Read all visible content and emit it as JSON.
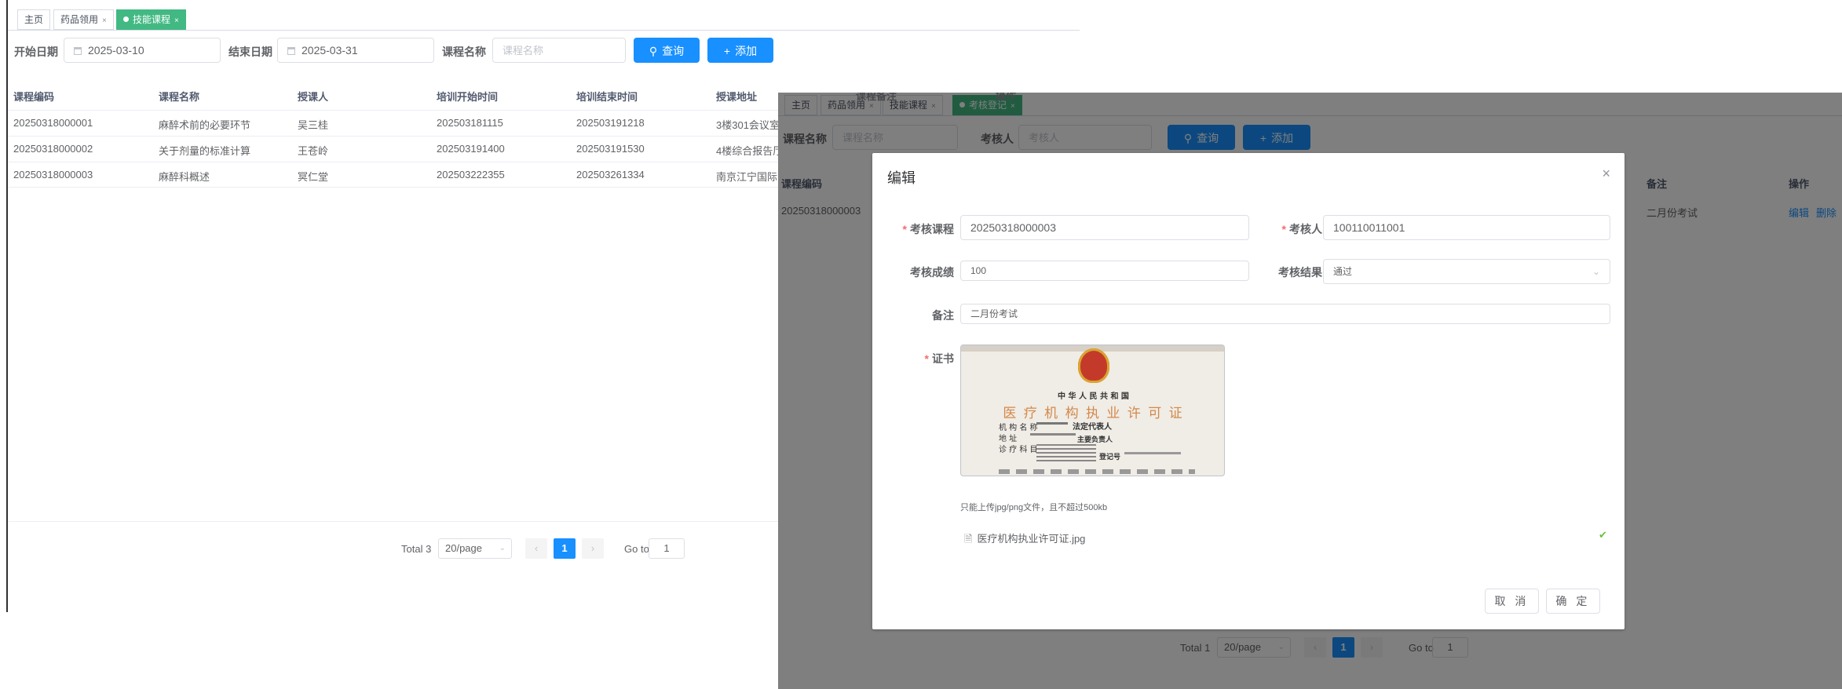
{
  "left_window": {
    "tabs": [
      {
        "label": "主页",
        "closable": false,
        "active": false
      },
      {
        "label": "药品领用",
        "closable": true,
        "active": false
      },
      {
        "label": "技能课程",
        "closable": true,
        "active": true
      }
    ],
    "filters": {
      "start_label": "开始日期",
      "start_value": "2025-03-10",
      "end_label": "结束日期",
      "end_value": "2025-03-31",
      "name_label": "课程名称",
      "name_placeholder": "课程名称",
      "search_label": "查询",
      "add_label": "添加"
    },
    "table": {
      "columns": [
        "课程编码",
        "课程名称",
        "授课人",
        "培训开始时间",
        "培训结束时间",
        "授课地址"
      ],
      "rows": [
        [
          "20250318000001",
          "麻醉术前的必要环节",
          "吴三桂",
          "202503181115",
          "202503191218",
          "3楼301会议室"
        ],
        [
          "20250318000002",
          "关于剂量的标准计算",
          "王苍岭",
          "202503191400",
          "202503191530",
          "4楼综合报告厅"
        ],
        [
          "20250318000003",
          "麻醉科概述",
          "冥仁堂",
          "202503222355",
          "202503261334",
          "南京江宁国际"
        ]
      ]
    },
    "pager": {
      "total": "Total 3",
      "size": "20/page",
      "page": "1",
      "goto_label": "Go to",
      "goto_value": "1"
    }
  },
  "right_window": {
    "tabs": [
      {
        "label": "主页",
        "closable": false,
        "active": false
      },
      {
        "label": "药品领用",
        "closable": true,
        "active": false
      },
      {
        "label": "技能课程",
        "closable": true,
        "active": false
      },
      {
        "label": "考核登记",
        "closable": true,
        "active": true
      }
    ],
    "hidden_headers": [
      "课程备注",
      "操作"
    ],
    "filters": {
      "name_label": "课程名称",
      "name_placeholder": "课程名称",
      "person_label": "考核人",
      "person_placeholder": "考核人",
      "search_label": "查询",
      "add_label": "添加"
    },
    "table": {
      "columns": [
        "课程编码",
        "备注",
        "操作"
      ],
      "row": {
        "code": "20250318000003",
        "remark": "二月份考试",
        "edit": "编辑",
        "delete": "删除"
      }
    },
    "pager": {
      "total": "Total 1",
      "size": "20/page",
      "page": "1",
      "goto_label": "Go to",
      "goto_value": "1"
    },
    "dialog": {
      "title": "编辑",
      "course_label": "考核课程",
      "course_value": "20250318000003",
      "person_label": "考核人",
      "person_value": "100110011001",
      "score_label": "考核成绩",
      "score_value": "100",
      "result_label": "考核结果",
      "result_value": "通过",
      "remark_label": "备注",
      "remark_value": "二月份考试",
      "cert_label": "证书",
      "cert": {
        "line1": "中 华 人 民 共 和 国",
        "line2": "医 疗 机 构 执 业 许 可 证",
        "field1": "机 构 名 称",
        "field2": "地  址",
        "field3": "诊 疗 科 目",
        "right1": "法定代表人",
        "right2": "主要负责人",
        "right3": "登记号"
      },
      "hint": "只能上传jpg/png文件，且不超过500kb",
      "file_name": "医疗机构执业许可证.jpg",
      "cancel_label": "取 消",
      "confirm_label": "确 定"
    }
  },
  "colors": {
    "primary": "#1890ff",
    "tag_active": "#42b983",
    "required": "#f56c6c",
    "success": "#67c23a"
  }
}
